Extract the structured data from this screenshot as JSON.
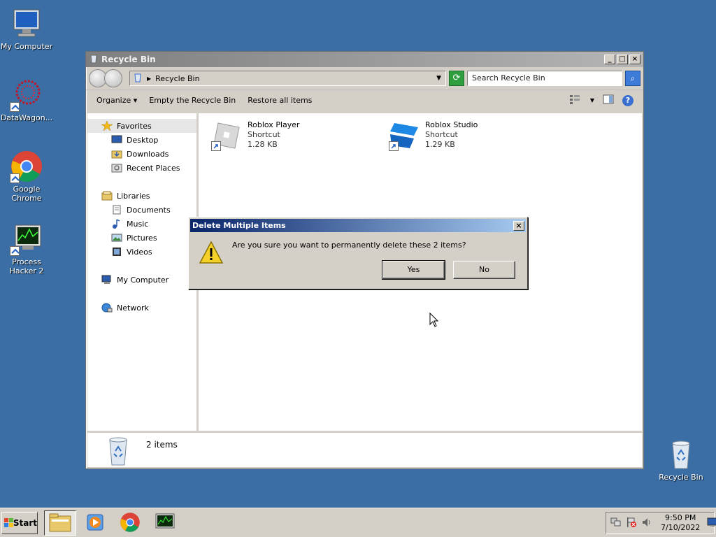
{
  "desktop": {
    "icons": [
      {
        "label": "My Computer"
      },
      {
        "label": "DataWagon..."
      },
      {
        "label": "Google Chrome"
      },
      {
        "label": "Process Hacker 2"
      },
      {
        "label": "Recycle Bin"
      }
    ]
  },
  "window": {
    "title": "Recycle Bin",
    "address": "Recycle Bin",
    "search_placeholder": "Search Recycle Bin",
    "toolbar": {
      "organize": "Organize",
      "empty": "Empty the Recycle Bin",
      "restore": "Restore all items"
    },
    "nav": {
      "favorites": {
        "label": "Favorites",
        "items": [
          "Desktop",
          "Downloads",
          "Recent Places"
        ]
      },
      "libraries": {
        "label": "Libraries",
        "items": [
          "Documents",
          "Music",
          "Pictures",
          "Videos"
        ]
      },
      "computer": "My Computer",
      "network": "Network"
    },
    "files": [
      {
        "name": "Roblox Player",
        "type": "Shortcut",
        "size": "1.28 KB"
      },
      {
        "name": "Roblox Studio",
        "type": "Shortcut",
        "size": "1.29 KB"
      }
    ],
    "status": "2 items"
  },
  "dialog": {
    "title": "Delete Multiple Items",
    "message": "Are you sure you want to permanently delete these 2 items?",
    "yes": "Yes",
    "no": "No"
  },
  "taskbar": {
    "start": "Start",
    "time": "9:50 PM",
    "date": "7/10/2022"
  },
  "colors": {
    "desktop": "#3a6ea5",
    "dialog_title": "#0a246a"
  }
}
